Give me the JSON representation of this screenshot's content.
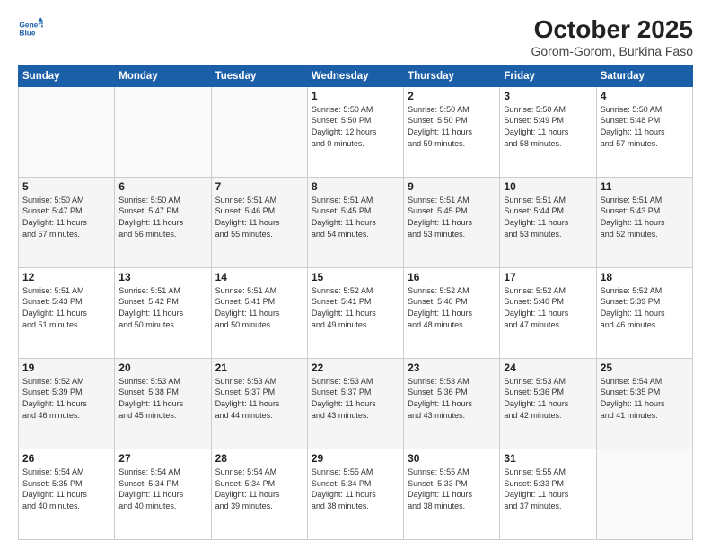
{
  "header": {
    "logo_line1": "General",
    "logo_line2": "Blue",
    "month_title": "October 2025",
    "subtitle": "Gorom-Gorom, Burkina Faso"
  },
  "weekdays": [
    "Sunday",
    "Monday",
    "Tuesday",
    "Wednesday",
    "Thursday",
    "Friday",
    "Saturday"
  ],
  "weeks": [
    [
      {
        "day": "",
        "info": ""
      },
      {
        "day": "",
        "info": ""
      },
      {
        "day": "",
        "info": ""
      },
      {
        "day": "1",
        "info": "Sunrise: 5:50 AM\nSunset: 5:50 PM\nDaylight: 12 hours\nand 0 minutes."
      },
      {
        "day": "2",
        "info": "Sunrise: 5:50 AM\nSunset: 5:50 PM\nDaylight: 11 hours\nand 59 minutes."
      },
      {
        "day": "3",
        "info": "Sunrise: 5:50 AM\nSunset: 5:49 PM\nDaylight: 11 hours\nand 58 minutes."
      },
      {
        "day": "4",
        "info": "Sunrise: 5:50 AM\nSunset: 5:48 PM\nDaylight: 11 hours\nand 57 minutes."
      }
    ],
    [
      {
        "day": "5",
        "info": "Sunrise: 5:50 AM\nSunset: 5:47 PM\nDaylight: 11 hours\nand 57 minutes."
      },
      {
        "day": "6",
        "info": "Sunrise: 5:50 AM\nSunset: 5:47 PM\nDaylight: 11 hours\nand 56 minutes."
      },
      {
        "day": "7",
        "info": "Sunrise: 5:51 AM\nSunset: 5:46 PM\nDaylight: 11 hours\nand 55 minutes."
      },
      {
        "day": "8",
        "info": "Sunrise: 5:51 AM\nSunset: 5:45 PM\nDaylight: 11 hours\nand 54 minutes."
      },
      {
        "day": "9",
        "info": "Sunrise: 5:51 AM\nSunset: 5:45 PM\nDaylight: 11 hours\nand 53 minutes."
      },
      {
        "day": "10",
        "info": "Sunrise: 5:51 AM\nSunset: 5:44 PM\nDaylight: 11 hours\nand 53 minutes."
      },
      {
        "day": "11",
        "info": "Sunrise: 5:51 AM\nSunset: 5:43 PM\nDaylight: 11 hours\nand 52 minutes."
      }
    ],
    [
      {
        "day": "12",
        "info": "Sunrise: 5:51 AM\nSunset: 5:43 PM\nDaylight: 11 hours\nand 51 minutes."
      },
      {
        "day": "13",
        "info": "Sunrise: 5:51 AM\nSunset: 5:42 PM\nDaylight: 11 hours\nand 50 minutes."
      },
      {
        "day": "14",
        "info": "Sunrise: 5:51 AM\nSunset: 5:41 PM\nDaylight: 11 hours\nand 50 minutes."
      },
      {
        "day": "15",
        "info": "Sunrise: 5:52 AM\nSunset: 5:41 PM\nDaylight: 11 hours\nand 49 minutes."
      },
      {
        "day": "16",
        "info": "Sunrise: 5:52 AM\nSunset: 5:40 PM\nDaylight: 11 hours\nand 48 minutes."
      },
      {
        "day": "17",
        "info": "Sunrise: 5:52 AM\nSunset: 5:40 PM\nDaylight: 11 hours\nand 47 minutes."
      },
      {
        "day": "18",
        "info": "Sunrise: 5:52 AM\nSunset: 5:39 PM\nDaylight: 11 hours\nand 46 minutes."
      }
    ],
    [
      {
        "day": "19",
        "info": "Sunrise: 5:52 AM\nSunset: 5:39 PM\nDaylight: 11 hours\nand 46 minutes."
      },
      {
        "day": "20",
        "info": "Sunrise: 5:53 AM\nSunset: 5:38 PM\nDaylight: 11 hours\nand 45 minutes."
      },
      {
        "day": "21",
        "info": "Sunrise: 5:53 AM\nSunset: 5:37 PM\nDaylight: 11 hours\nand 44 minutes."
      },
      {
        "day": "22",
        "info": "Sunrise: 5:53 AM\nSunset: 5:37 PM\nDaylight: 11 hours\nand 43 minutes."
      },
      {
        "day": "23",
        "info": "Sunrise: 5:53 AM\nSunset: 5:36 PM\nDaylight: 11 hours\nand 43 minutes."
      },
      {
        "day": "24",
        "info": "Sunrise: 5:53 AM\nSunset: 5:36 PM\nDaylight: 11 hours\nand 42 minutes."
      },
      {
        "day": "25",
        "info": "Sunrise: 5:54 AM\nSunset: 5:35 PM\nDaylight: 11 hours\nand 41 minutes."
      }
    ],
    [
      {
        "day": "26",
        "info": "Sunrise: 5:54 AM\nSunset: 5:35 PM\nDaylight: 11 hours\nand 40 minutes."
      },
      {
        "day": "27",
        "info": "Sunrise: 5:54 AM\nSunset: 5:34 PM\nDaylight: 11 hours\nand 40 minutes."
      },
      {
        "day": "28",
        "info": "Sunrise: 5:54 AM\nSunset: 5:34 PM\nDaylight: 11 hours\nand 39 minutes."
      },
      {
        "day": "29",
        "info": "Sunrise: 5:55 AM\nSunset: 5:34 PM\nDaylight: 11 hours\nand 38 minutes."
      },
      {
        "day": "30",
        "info": "Sunrise: 5:55 AM\nSunset: 5:33 PM\nDaylight: 11 hours\nand 38 minutes."
      },
      {
        "day": "31",
        "info": "Sunrise: 5:55 AM\nSunset: 5:33 PM\nDaylight: 11 hours\nand 37 minutes."
      },
      {
        "day": "",
        "info": ""
      }
    ]
  ]
}
